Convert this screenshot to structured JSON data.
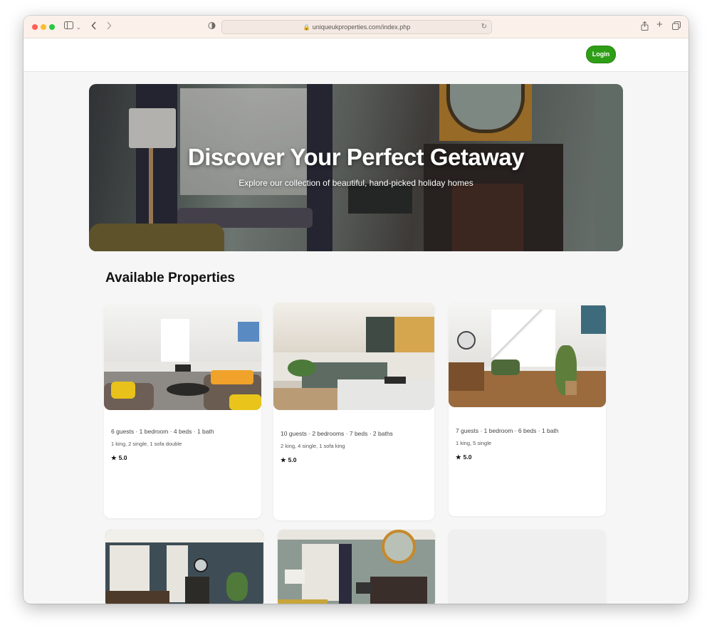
{
  "browser": {
    "url": "uniqueukproperties.com/index.php"
  },
  "header": {
    "login_label": "Login"
  },
  "hero": {
    "title": "Discover Your Perfect Getaway",
    "subtitle": "Explore our collection of beautiful, hand-picked holiday homes"
  },
  "section": {
    "title": "Available Properties"
  },
  "properties": [
    {
      "summary": "6 guests · 1 bedroom · 4 beds · 1 bath",
      "beds": "1 king, 2 single, 1 sofa double",
      "rating": "5.0"
    },
    {
      "summary": "10 guests · 2 bedrooms · 7 beds · 2 baths",
      "beds": "2 king, 4 single, 1 sofa king",
      "rating": "5.0"
    },
    {
      "summary": "7 guests · 1 bedroom · 6 beds · 1 bath",
      "beds": "1 king, 5 single",
      "rating": "5.0"
    }
  ],
  "colors": {
    "accent": "#2f9e17",
    "page_bg": "#f6f6f6"
  },
  "icons": [
    "sidebar-icon",
    "back-icon",
    "forward-icon",
    "shield-icon",
    "lock-icon",
    "reload-icon",
    "share-icon",
    "new-tab-icon",
    "tabs-icon",
    "star-icon"
  ]
}
